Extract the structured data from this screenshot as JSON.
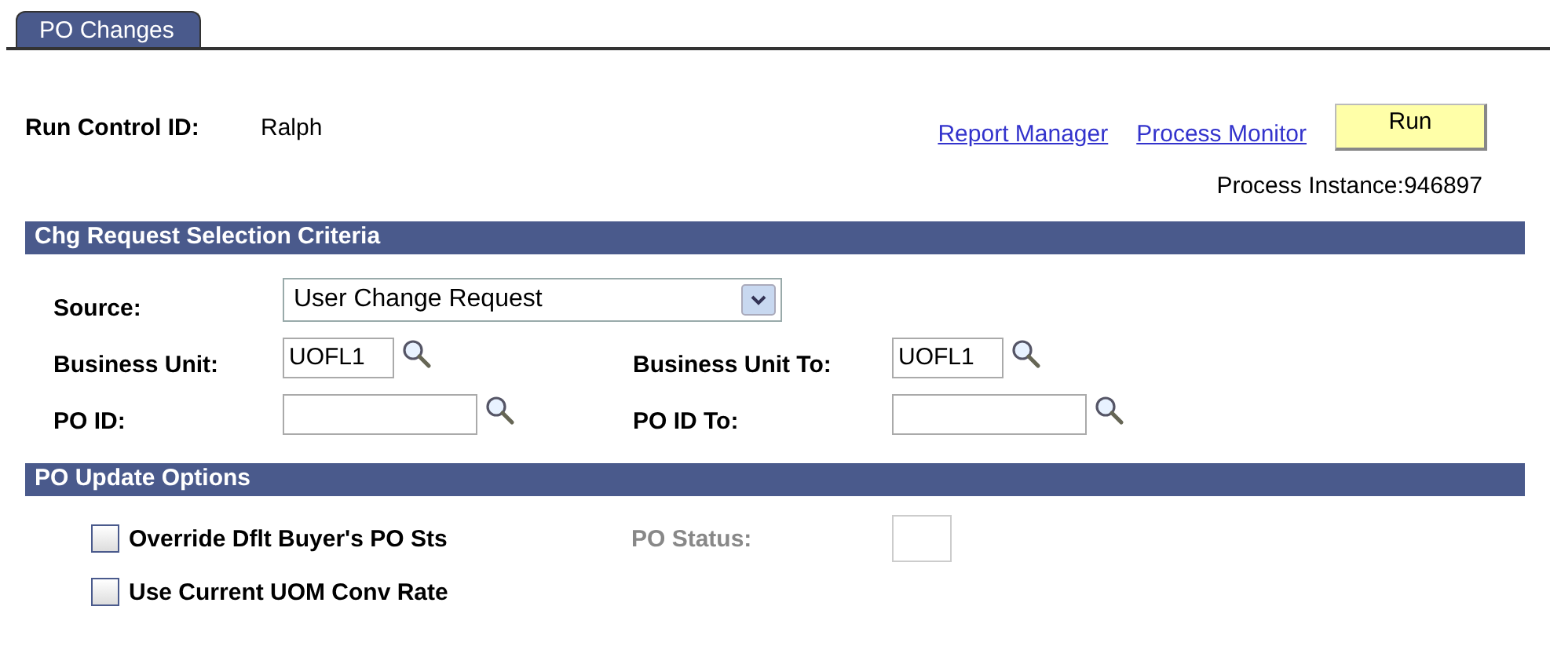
{
  "tabs": [
    {
      "label": "PO Changes",
      "selected": true
    }
  ],
  "run_control": {
    "label": "Run Control ID:",
    "value": "Ralph"
  },
  "links": [
    "Report Manager",
    "Process Monitor"
  ],
  "run_button": "Run",
  "process_instance": "Process Instance:946897",
  "criteria": {
    "title": "Chg Request Selection Criteria",
    "source": {
      "label": "Source:",
      "value": "User Change Request"
    },
    "rows": [
      {
        "label": "Business Unit:",
        "value": "UOFL1",
        "label_to": "Business Unit To:",
        "value_to": "UOFL1"
      },
      {
        "label": "PO ID:",
        "label_to": "PO ID To:"
      }
    ]
  },
  "options": {
    "title": "PO Update Options",
    "checkboxes": [
      {
        "label": "Override Dflt Buyer's PO Sts",
        "checked": false
      },
      {
        "label": "Use Current UOM Conv Rate",
        "checked": false
      }
    ],
    "po_status": {
      "label": "PO Status:",
      "disabled": true
    }
  }
}
